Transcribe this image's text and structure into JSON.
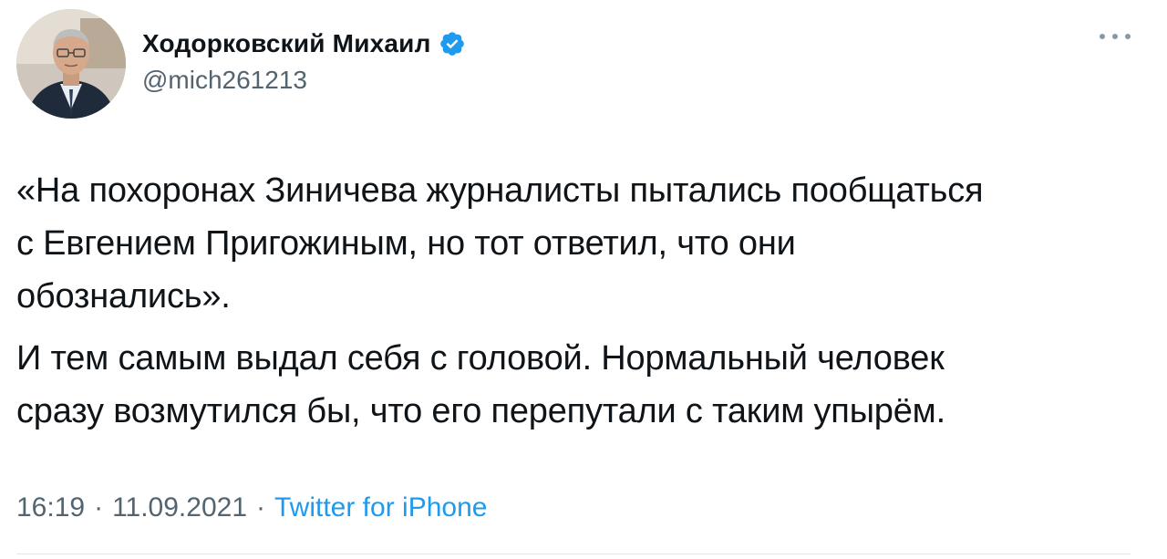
{
  "author": {
    "display_name": "Ходорковский Михаил",
    "handle": "@mich261213",
    "verified": true,
    "avatar_icon": "profile-avatar",
    "verified_icon": "verified-badge-icon",
    "verified_color": "#1d9bf0"
  },
  "tweet": {
    "paragraphs": [
      "«На похоронах Зиничева журналисты пытались пообщаться\nс Евгением Пригожиным, но тот ответил, что они\nобознались».",
      "И тем самым выдал себя с головой. Нормальный человек\nсразу возмутился бы, что его перепутали с таким упырём."
    ]
  },
  "meta": {
    "time": "16:19",
    "separator": "·",
    "date": "11.09.2021",
    "source": "Twitter for iPhone",
    "source_color": "#1d9bf0"
  },
  "actions": {
    "more_icon": "more-dots-icon"
  }
}
